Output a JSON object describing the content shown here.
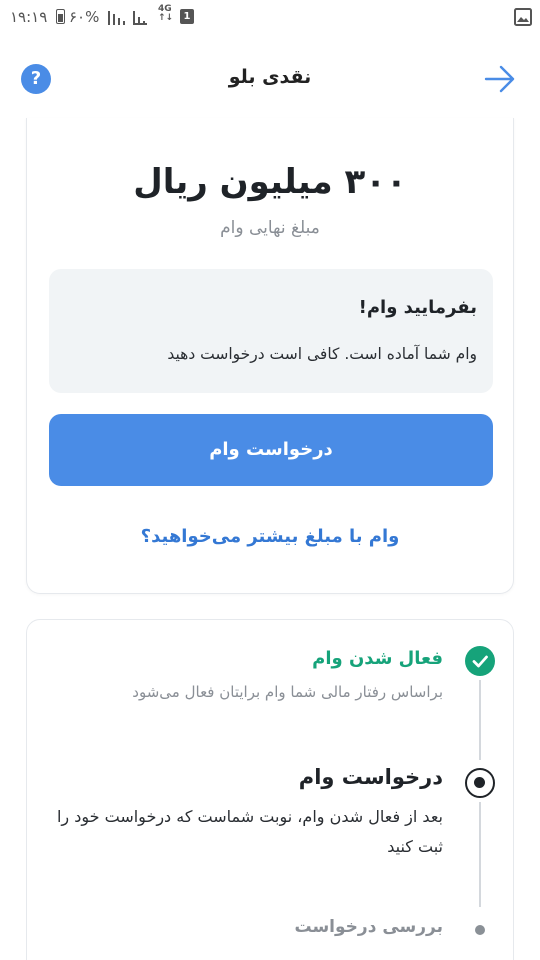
{
  "status_bar": {
    "time": "۱۹:۱۹",
    "battery": "۶۰%",
    "network": "4G",
    "notification_count": "1"
  },
  "header": {
    "title": "نقدی بلو",
    "help_icon": "help-circle-icon",
    "back_icon": "arrow-right-icon"
  },
  "loan": {
    "amount": "۳۰۰ میلیون ریال",
    "caption": "مبلغ نهایی وام",
    "info_title": "بفرمایید وام!",
    "info_text": "وام شما آماده است. کافی است درخواست دهید",
    "request_button": "درخواست وام",
    "more_link": "وام با مبلغ بیشتر می‌خواهید؟"
  },
  "steps": [
    {
      "title": "فعال شدن وام",
      "description": "براساس رفتار مالی شما وام برایتان فعال می‌شود",
      "state": "done"
    },
    {
      "title": "درخواست وام",
      "description": "بعد از فعال شدن وام، نوبت شماست که درخواست خود را ثبت کنید",
      "state": "current"
    },
    {
      "title": "بررسی درخواست",
      "description": "",
      "state": "pending"
    }
  ],
  "colors": {
    "accent": "#4a8ce6",
    "link": "#3478d4",
    "success": "#16a37a",
    "muted": "#8a8f96"
  }
}
